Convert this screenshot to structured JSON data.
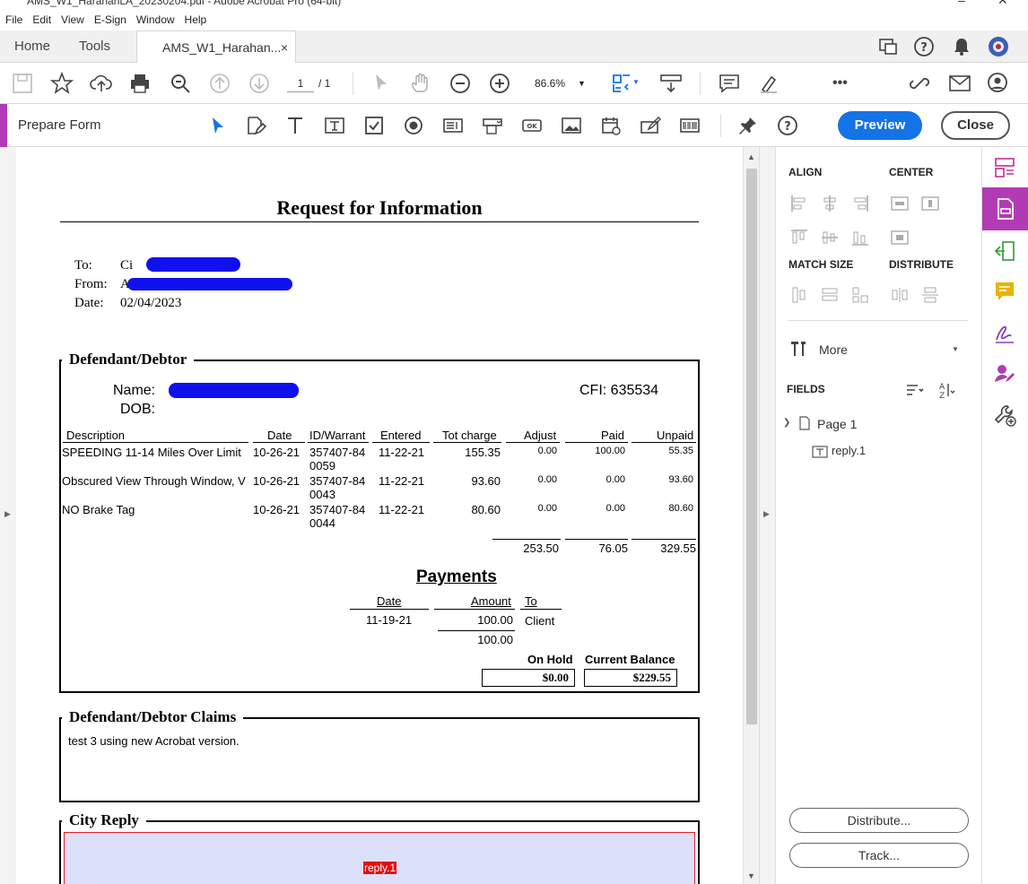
{
  "window": {
    "title": "AMS_W1_HarahanLA_20230204.pdf - Adobe Acrobat Pro (64-bit)"
  },
  "menu": [
    "File",
    "Edit",
    "View",
    "E-Sign",
    "Window",
    "Help"
  ],
  "tabs": {
    "home": "Home",
    "tools": "Tools",
    "doc": "AMS_W1_Harahan...",
    "close": "×"
  },
  "toolbar": {
    "page_current": "1",
    "page_total": "/ 1",
    "zoom": "86.6%",
    "more": "•••"
  },
  "prepare": {
    "title": "Prepare Form",
    "preview": "Preview",
    "close": "Close"
  },
  "panel": {
    "align": "ALIGN",
    "center": "CENTER",
    "match_size": "MATCH SIZE",
    "distribute": "DISTRIBUTE",
    "more": "More",
    "fields": "FIELDS",
    "page": "Page 1",
    "field": "reply.1",
    "distribute_btn": "Distribute...",
    "track_btn": "Track..."
  },
  "doc": {
    "title": "Request for Information",
    "to_label": "To:",
    "from_label": "From:",
    "date_label": "Date:",
    "to_value": "Ci",
    "from_value": "A",
    "date_value": "02/04/2023",
    "debtor_title": "Defendant/Debtor",
    "name_label": "Name:",
    "dob_label": "DOB:",
    "cfi": "CFI: 635534",
    "columns": [
      "Description",
      "Date",
      "ID/Warrant",
      "Entered",
      "Tot charge",
      "Adjust",
      "Paid",
      "Unpaid"
    ],
    "rows": [
      {
        "desc": "SPEEDING 11-14 Miles Over Limit",
        "date": "10-26-21",
        "id1": "357407-84",
        "id2": "0059",
        "entered": "11-22-21",
        "tot": "155.35",
        "adjust": "0.00",
        "paid": "100.00",
        "unpaid": "55.35"
      },
      {
        "desc": "Obscured View Through Window, V",
        "date": "10-26-21",
        "id1": "357407-84",
        "id2": "0043",
        "entered": "11-22-21",
        "tot": "93.60",
        "adjust": "0.00",
        "paid": "0.00",
        "unpaid": "93.60"
      },
      {
        "desc": "NO Brake Tag",
        "date": "10-26-21",
        "id1": "357407-84",
        "id2": "0044",
        "entered": "11-22-21",
        "tot": "80.60",
        "adjust": "0.00",
        "paid": "0.00",
        "unpaid": "80.60"
      }
    ],
    "totals": {
      "tot": "253.50",
      "paid": "76.05",
      "unpaid": "329.55"
    },
    "payments_title": "Payments",
    "pay_cols": [
      "Date",
      "Amount",
      "To"
    ],
    "pay_row": {
      "date": "11-19-21",
      "amount": "100.00",
      "to": "Client"
    },
    "pay_total": "100.00",
    "on_hold_label": "On Hold",
    "balance_label": "Current Balance",
    "on_hold": "$0.00",
    "balance": "$229.55",
    "claims_title": "Defendant/Debtor Claims",
    "claims_text": "test 3 using new Acrobat version.",
    "reply_title": "City Reply",
    "reply_field": "reply.1"
  }
}
